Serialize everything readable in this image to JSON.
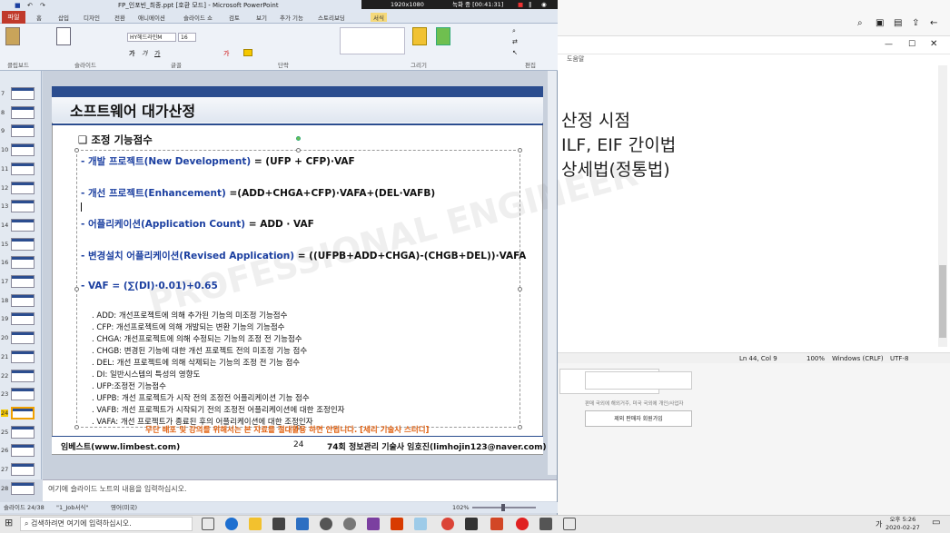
{
  "ppt": {
    "title": "FP_인포빈_최종.ppt [호환 모드] - Microsoft PowerPoint",
    "recording": "1920x1080",
    "rec_time": "녹화 중 [00:41:31]",
    "file_tab": "파일",
    "tabs": [
      "홈",
      "삽입",
      "디자인",
      "전환",
      "애니메이션",
      "슬라이드 쇼",
      "검토",
      "보기",
      "추가 기능",
      "스토리보딩",
      "서식"
    ],
    "groups": [
      "클립보드",
      "슬라이드",
      "글꼴",
      "단락",
      "그리기",
      "편집"
    ],
    "font_name": "HY헤드라인M",
    "font_size": "16",
    "thumb_numbers": [
      "7",
      "8",
      "9",
      "10",
      "11",
      "12",
      "13",
      "14",
      "15",
      "16",
      "17",
      "18",
      "19",
      "20",
      "21",
      "22",
      "23",
      "24",
      "25",
      "26",
      "27",
      "28"
    ],
    "active_slide": "24",
    "notes_placeholder": "여기에 슬라이드 노트의 내용을 입력하십시오.",
    "status_left": "슬라이드 24/38",
    "status_theme": "\"1_Job서식\"",
    "status_lang": "영어(미국)",
    "zoom": "102%"
  },
  "slide": {
    "title": "소프트웨어 대가산정",
    "section": "❑ 조정 기능점수",
    "lines": [
      {
        "label": "- 개발 프로젝트(New Development)",
        "formula": " = (UFP + CFP)·VAF"
      },
      {
        "label": "- 개선 프로젝트(Enhancement)",
        "formula": " =(ADD+CHGA+CFP)·VAFA+(DEL·VAFB)"
      },
      {
        "label": "- 어플리케이션(Application Count)",
        "formula": " = ADD · VAF"
      },
      {
        "label": "- 변경설치 어플리케이션(Revised Application)",
        "formula": " = ((UFPB+ADD+CHGA)-(CHGB+DEL))·VAFA"
      },
      {
        "label": "- VAF = (∑(DI)·0.01)+0.65",
        "formula": ""
      }
    ],
    "defs": [
      ". ADD: 개선프로젝트에 의해 추가된 기능의 미조정 기능점수",
      ". CFP: 개선프로젝트에 의해 개발되는 변환 기능의 기능점수",
      ". CHGA: 개선프로젝트에 의해 수정되는 기능의 조정 전 기능점수",
      ". CHGB: 변경된 기능에 대한 개선 프로젝트 전의 미조정 기능 점수",
      ". DEL: 개선 프로젝트에 의해 삭제되는 기능의 조정 전 기능 점수",
      ". DI: 일반시스템의 특성의 영향도",
      ". UFP:조정전 기능점수",
      ". UFPB: 개선 프로젝트가 시작 전의 조정전 어플리케이션 기능 점수",
      ". VAFB: 개선 프로젝트가 시작되기 전의 조정전 어플리케이션에 대한 조정인자",
      ". VAFA: 개선 프로젝트가 종료된 후의 어플리케이션에 대한 조정인자"
    ],
    "warning": "무단 배포 및 강의를 위해서는 본 자료를 절대활용 하면 안됩니다. [세리 기술사 스터디]",
    "footer_left": "임베스트(www.limbest.com)",
    "page": "24",
    "footer_right": "74회 정보관리 기술사 임호진(limhojin123@naver.com)",
    "watermark": "PROFESSIONAL ENGINEER"
  },
  "editor": {
    "menu": "도움말",
    "lines": [
      "산정 시점",
      "ILF, EIF 간이법",
      "상세법(정통법)"
    ],
    "status": [
      "Ln 44, Col 9",
      "100%",
      "Windows (CRLF)",
      "UTF-8"
    ]
  },
  "browser_snip": {
    "btn1": "제외 판매자 회원가입",
    "small": "판매 국외에 해외거주, 미국 국외에 개인/사업자"
  },
  "taskbar": {
    "search_placeholder": "검색하려면 여기에 입력하십시오.",
    "time": "오후 5:26",
    "date": "2020-02-27",
    "ime": "가"
  }
}
